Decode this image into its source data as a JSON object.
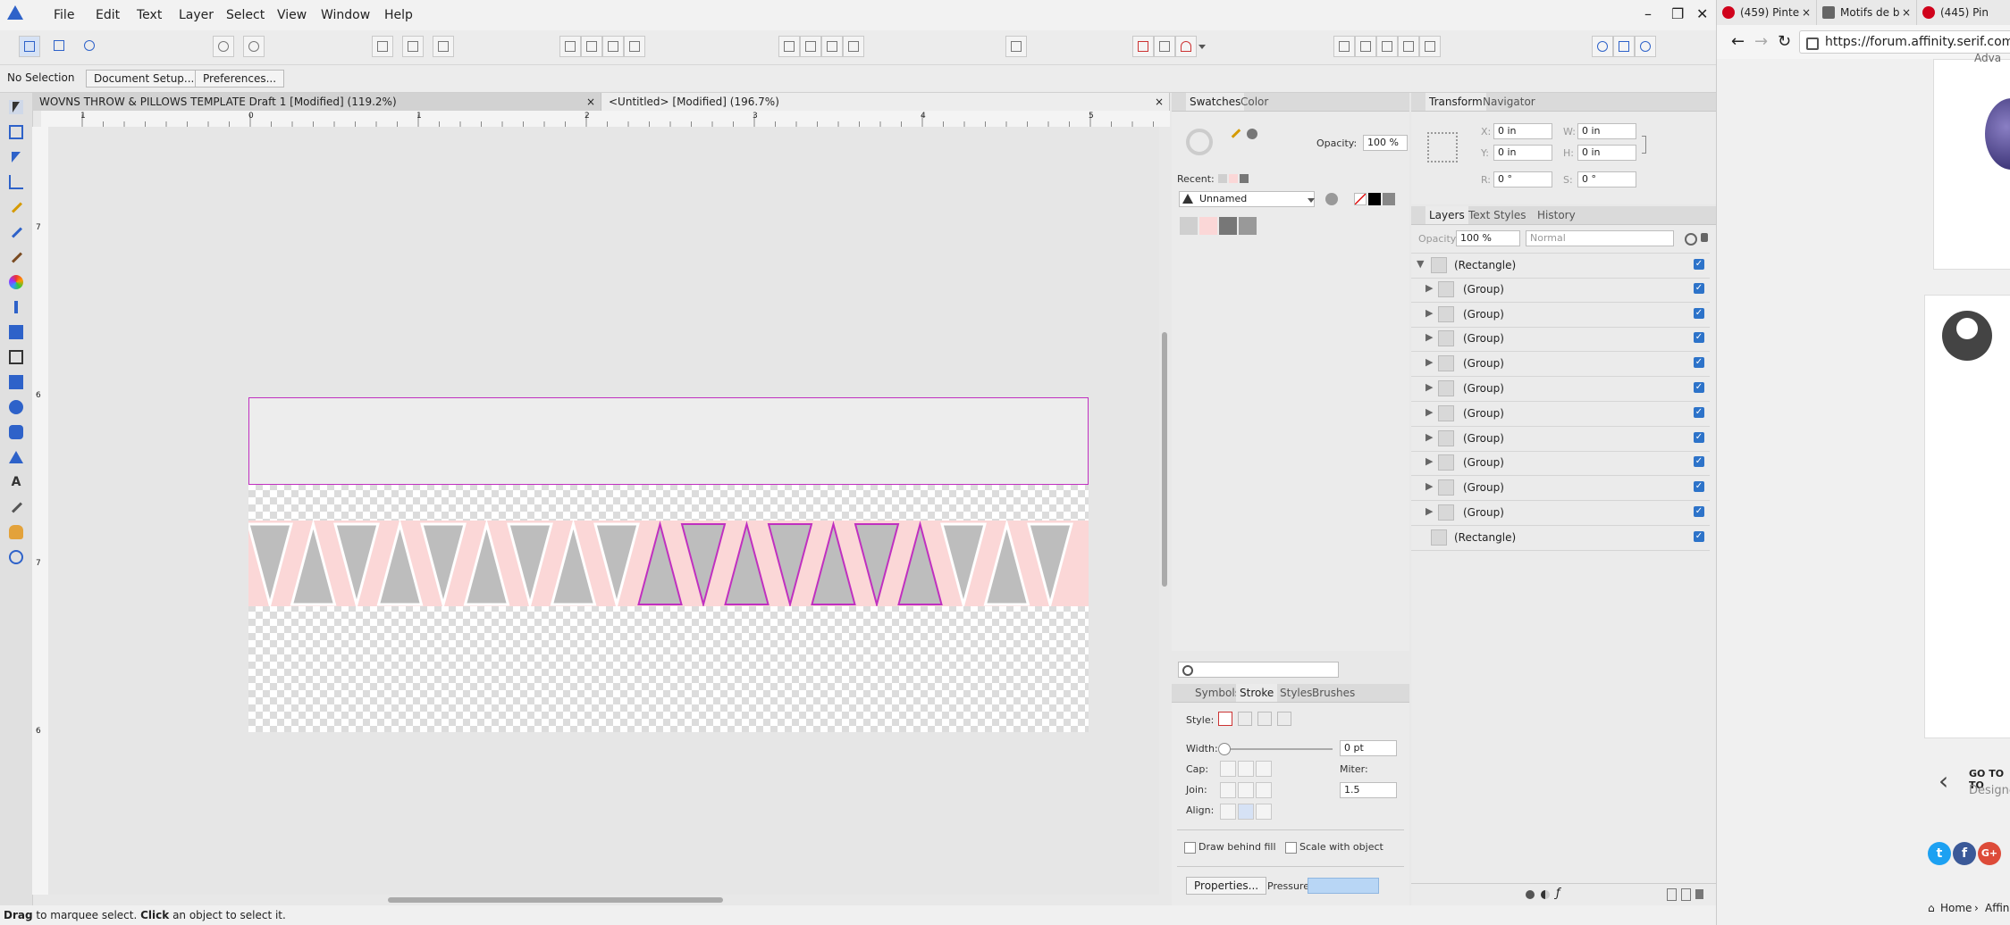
{
  "app": {
    "menu": [
      "File",
      "Edit",
      "Text",
      "Layer",
      "Select",
      "View",
      "Window",
      "Help"
    ],
    "window_controls": [
      "–",
      "❐",
      "✕"
    ]
  },
  "context_bar": {
    "selection": "No Selection",
    "document_setup": "Document Setup...",
    "preferences": "Preferences..."
  },
  "doc_tabs": [
    {
      "label": "WOVNS THROW & PILLOWS TEMPLATE Draft 1 [Modified] (119.2%)",
      "close": "×"
    },
    {
      "label": "<Untitled> [Modified] (196.7%)",
      "close": "×"
    }
  ],
  "rulers": {
    "top": [
      "1",
      "0",
      "1",
      "2",
      "3",
      "4",
      "5"
    ],
    "left": [
      "7",
      "6",
      "7",
      "6"
    ]
  },
  "pattern": {
    "colors": {
      "triangle": "#bdbdbd",
      "outline": "#ffffff",
      "band": "#fbd7d7",
      "highlight": "#c030c0"
    },
    "triangle_count": 19,
    "highlighted_range": [
      9,
      15
    ]
  },
  "swatches_panel": {
    "tabs": [
      "Swatches",
      "Color"
    ],
    "opacity_label": "Opacity:",
    "opacity_value": "100 %",
    "recent_label": "Recent:",
    "palette_name": "Unnamed",
    "colors": [
      "#cfcfcf",
      "#fbd7d7",
      "#777777",
      "#999999"
    ]
  },
  "transform_panel": {
    "tabs": [
      "Transform",
      "Navigator"
    ],
    "x_label": "X:",
    "x": "0 in",
    "y_label": "Y:",
    "y": "0 in",
    "w_label": "W:",
    "w": "0 in",
    "h_label": "H:",
    "h": "0 in",
    "r_label": "R:",
    "r": "0 °",
    "s_label": "S:",
    "s": "0 °"
  },
  "layers_panel": {
    "tabs": [
      "Layers",
      "Text Styles",
      "History"
    ],
    "opacity_label": "Opacity:",
    "opacity": "100 %",
    "blend": "Normal",
    "rows": [
      {
        "name": "(Rectangle)",
        "arrow": "▼"
      },
      {
        "name": "(Group)",
        "arrow": "▶"
      },
      {
        "name": "(Group)",
        "arrow": "▶"
      },
      {
        "name": "(Group)",
        "arrow": "▶"
      },
      {
        "name": "(Group)",
        "arrow": "▶"
      },
      {
        "name": "(Group)",
        "arrow": "▶"
      },
      {
        "name": "(Group)",
        "arrow": "▶"
      },
      {
        "name": "(Group)",
        "arrow": "▶"
      },
      {
        "name": "(Group)",
        "arrow": "▶"
      },
      {
        "name": "(Group)",
        "arrow": "▶"
      },
      {
        "name": "(Group)",
        "arrow": "▶"
      },
      {
        "name": "(Rectangle)",
        "arrow": ""
      }
    ]
  },
  "stroke_panel": {
    "tabs": [
      "Symbols",
      "Stroke",
      "Styles",
      "Brushes"
    ],
    "style_label": "Style:",
    "width_label": "Width:",
    "width": "0 pt",
    "cap_label": "Cap:",
    "miter_label": "Miter:",
    "miter": "1.5",
    "join_label": "Join:",
    "align_label": "Align:",
    "draw_behind": "Draw behind fill",
    "scale_with": "Scale with object",
    "properties": "Properties...",
    "pressure": "Pressure:"
  },
  "status": {
    "drag": "Drag",
    "text1": " to marquee select. ",
    "click": "Click",
    "text2": " an object to select it."
  },
  "browser": {
    "tabs": [
      {
        "label": "(459) Pinte",
        "close": "×"
      },
      {
        "label": "Motifs de b",
        "close": "×"
      },
      {
        "label": "(445) Pin",
        "close": "×"
      }
    ],
    "url": "https://forum.affinity.serif.com/ind",
    "snippet_top": "Adva",
    "go_to": "GO TO TO",
    "designer": "Designe",
    "breadcrumb_home": "Home",
    "breadcrumb_next": "Affin",
    "social": [
      "t",
      "f",
      "G+"
    ]
  }
}
